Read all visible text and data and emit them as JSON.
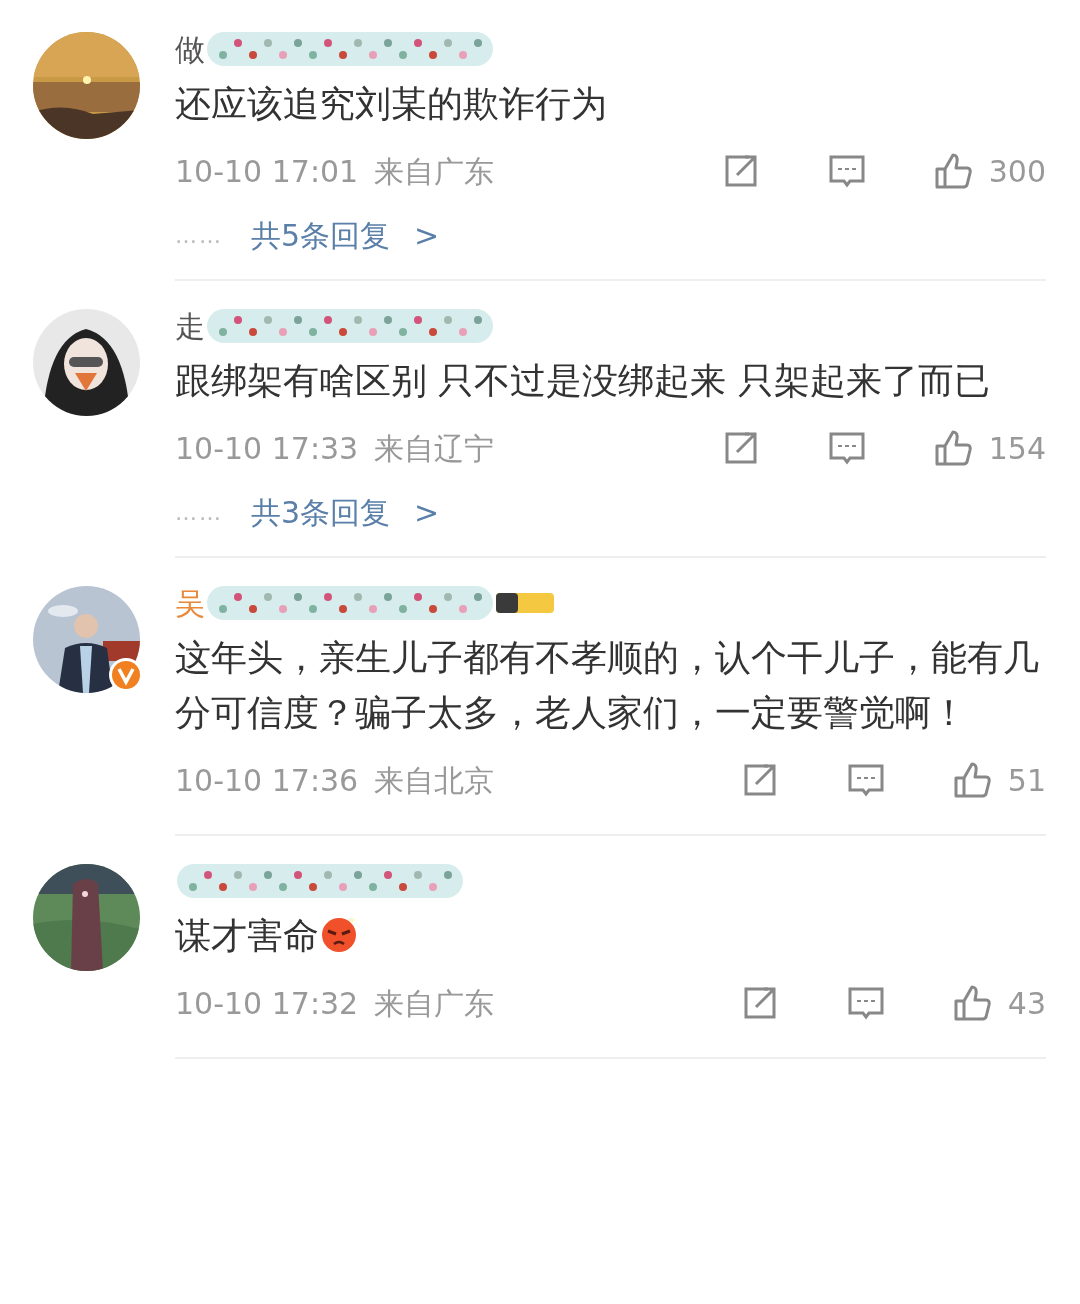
{
  "comments": [
    {
      "name": "做",
      "vip": false,
      "verified": false,
      "level_badge": false,
      "text": "还应该追究刘某的欺诈行为",
      "angry_emoji": false,
      "time": "10-10 17:01",
      "location": "来自广东",
      "likes": "300",
      "replies": {
        "dots": "……",
        "label": "共5条回复",
        "arrow": ">"
      }
    },
    {
      "name": "走",
      "vip": false,
      "verified": false,
      "level_badge": false,
      "text": "跟绑架有啥区别 只不过是没绑起来 只架起来了而已",
      "angry_emoji": false,
      "time": "10-10 17:33",
      "location": "来自辽宁",
      "likes": "154",
      "replies": {
        "dots": "……",
        "label": "共3条回复",
        "arrow": ">"
      }
    },
    {
      "name": "吴",
      "vip": true,
      "verified": true,
      "level_badge": true,
      "text": "这年头，亲生儿子都有不孝顺的，认个干儿子，能有几分可信度？骗子太多，老人家们，一定要警觉啊！",
      "angry_emoji": false,
      "time": "10-10 17:36",
      "location": "来自北京",
      "likes": "51"
    },
    {
      "vip": false,
      "verified": false,
      "level_badge": false,
      "text": "谋才害命",
      "angry_emoji": true,
      "time": "10-10 17:32",
      "location": "来自广东",
      "likes": "43"
    }
  ]
}
